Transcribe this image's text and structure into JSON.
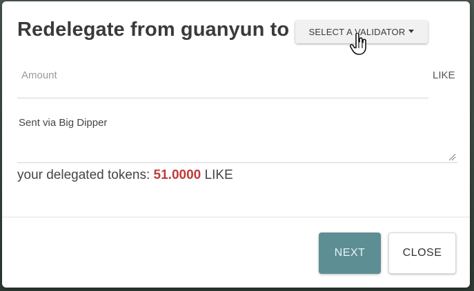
{
  "modal": {
    "title": "Redelegate from guanyun to",
    "validator_dropdown": {
      "label": "SELECT A VALIDATOR",
      "icon": "caret-down-icon"
    },
    "amount": {
      "placeholder": "Amount",
      "value": "",
      "unit": "LIKE"
    },
    "memo": {
      "value": "Sent via Big Dipper"
    },
    "delegated": {
      "prefix": "your delegated tokens: ",
      "amount": "51.0000",
      "unit": " LIKE"
    },
    "buttons": {
      "next": "NEXT",
      "close": "CLOSE"
    }
  },
  "colors": {
    "accent": "#5d8e94",
    "amount_highlight": "#c0393b",
    "title": "#3a3a3a"
  }
}
